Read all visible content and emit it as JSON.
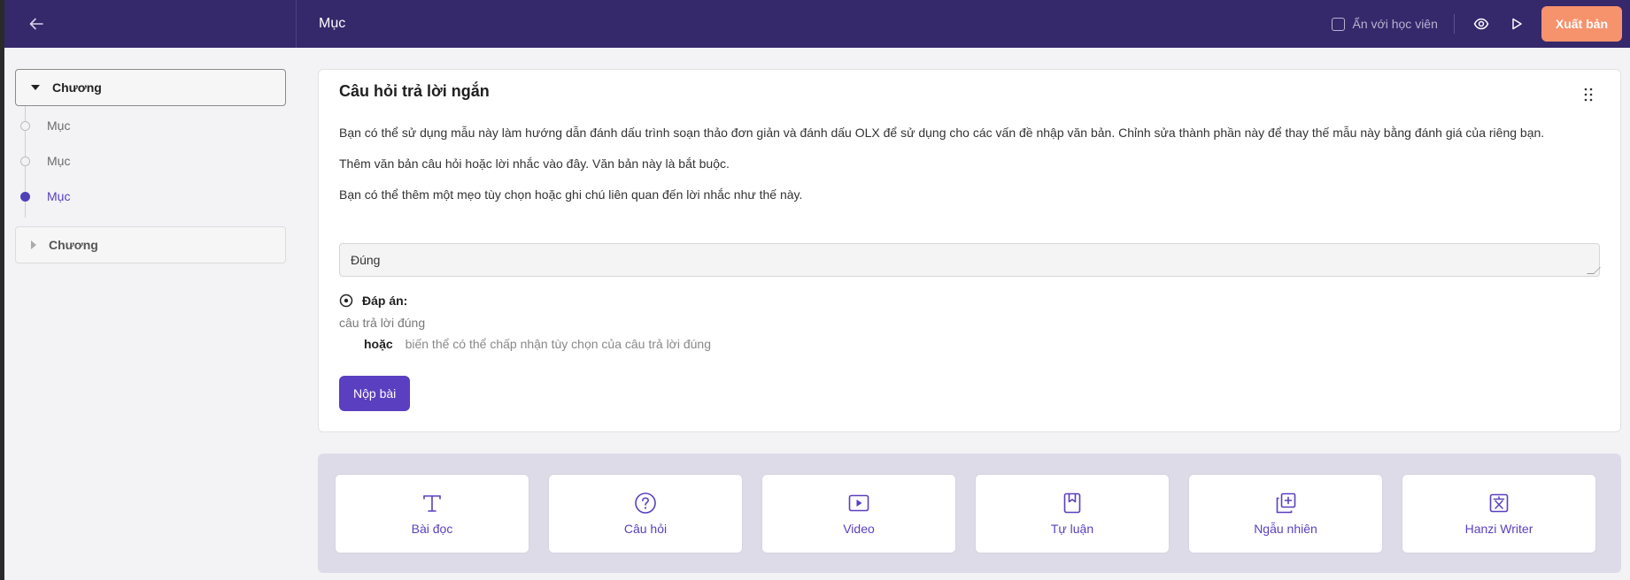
{
  "topbar": {
    "title": "Mục",
    "hide_from_learners_label": "Ẩn với học viên",
    "publish_label": "Xuất bản"
  },
  "sidebar": {
    "chapters": [
      {
        "label": "Chương",
        "expanded": true,
        "units": [
          {
            "label": "Mục",
            "active": false
          },
          {
            "label": "Mục",
            "active": false
          },
          {
            "label": "Mục",
            "active": true
          }
        ]
      },
      {
        "label": "Chương",
        "expanded": false
      }
    ]
  },
  "question": {
    "title": "Câu hỏi trả lời ngắn",
    "intro": "Bạn có thể sử dụng mẫu này làm hướng dẫn đánh dấu trình soạn thảo đơn giản và đánh dấu OLX để sử dụng cho các vấn đề nhập văn bản. Chỉnh sửa thành phần này để thay thế mẫu này bằng đánh giá của riêng bạn.",
    "prompt": "Thêm văn bản câu hỏi hoặc lời nhắc vào đây. Văn bản này là bắt buộc.",
    "hint": "Bạn có thể thêm một mẹo tùy chọn hoặc ghi chú liên quan đến lời nhắc như thế này.",
    "input_value": "Đúng",
    "answer_label": "Đáp án:",
    "correct_answer": "câu trả lời đúng",
    "or_label": "hoặc",
    "alt_answer": "biến thể có thể chấp nhận tùy chọn của câu trả lời đúng",
    "submit_label": "Nộp bài"
  },
  "add_components": [
    {
      "label": "Bài đọc",
      "icon": "text-icon"
    },
    {
      "label": "Câu hỏi",
      "icon": "question-icon"
    },
    {
      "label": "Video",
      "icon": "video-icon"
    },
    {
      "label": "Tự luận",
      "icon": "bookmark-icon"
    },
    {
      "label": "Ngẫu nhiên",
      "icon": "library-icon"
    },
    {
      "label": "Hanzi Writer",
      "icon": "translate-icon"
    }
  ],
  "colors": {
    "topbar": "#35286b",
    "accent": "#5a3fc0",
    "publish": "#f6926c"
  }
}
